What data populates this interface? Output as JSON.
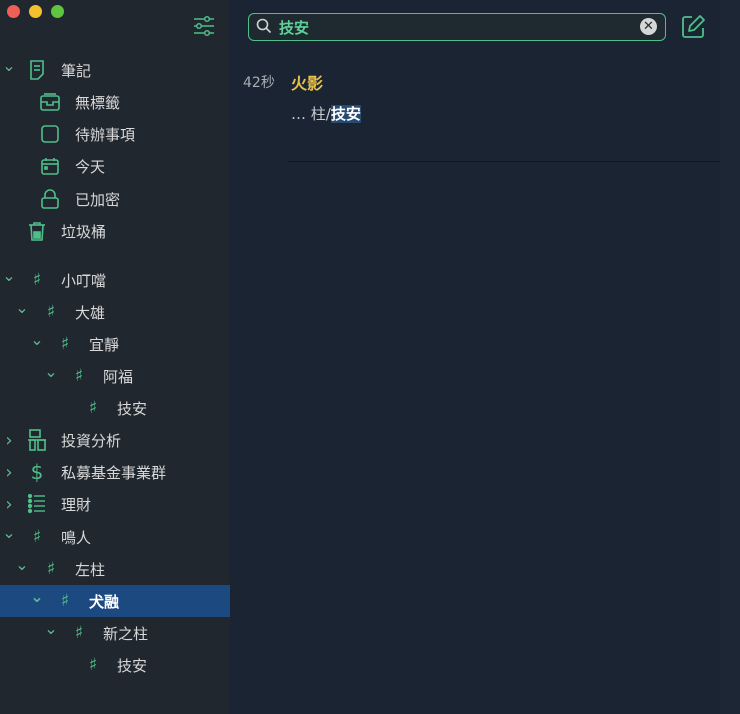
{
  "sidebar": {
    "items": [
      {
        "label": "筆記",
        "icon": "note-icon",
        "chevron": "down"
      },
      {
        "label": "無標籤",
        "icon": "inbox-icon"
      },
      {
        "label": "待辦事項",
        "icon": "checkbox-icon"
      },
      {
        "label": "今天",
        "icon": "calendar-icon"
      },
      {
        "label": "已加密",
        "icon": "lock-icon"
      },
      {
        "label": "垃圾桶",
        "icon": "trash-icon"
      },
      {
        "label": "小叮噹",
        "icon": "hash-icon",
        "chevron": "down"
      },
      {
        "label": "大雄",
        "icon": "hash-icon",
        "chevron": "down"
      },
      {
        "label": "宜靜",
        "icon": "hash-icon",
        "chevron": "down"
      },
      {
        "label": "阿福",
        "icon": "hash-icon",
        "chevron": "down"
      },
      {
        "label": "技安",
        "icon": "hash-icon"
      },
      {
        "label": "投資分析",
        "icon": "building-icon",
        "chevron": "right"
      },
      {
        "label": "私募基金事業群",
        "icon": "dollar-icon",
        "chevron": "right"
      },
      {
        "label": "理財",
        "icon": "list-icon",
        "chevron": "right"
      },
      {
        "label": "鳴人",
        "icon": "hash-icon",
        "chevron": "down"
      },
      {
        "label": "左柱",
        "icon": "hash-icon",
        "chevron": "down"
      },
      {
        "label": "犬融",
        "icon": "hash-icon",
        "chevron": "down",
        "selected": true
      },
      {
        "label": "新之柱",
        "icon": "hash-icon",
        "chevron": "down"
      },
      {
        "label": "技安",
        "icon": "hash-icon"
      }
    ]
  },
  "search": {
    "value": "技安"
  },
  "results": [
    {
      "time": "42秒",
      "title": "火影",
      "snippet_prefix": "… 柱/",
      "snippet_match": "技安"
    }
  ],
  "colors": {
    "accent": "#4fbf8a",
    "title": "#e5c14a",
    "selected": "#1c4a80"
  }
}
